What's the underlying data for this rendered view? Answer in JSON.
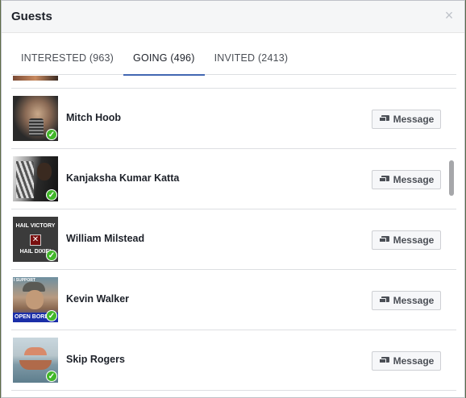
{
  "dialog": {
    "title": "Guests",
    "close_glyph": "×"
  },
  "tabs": [
    {
      "label": "INTERESTED (963)",
      "active": false
    },
    {
      "label": "GOING (496)",
      "active": true
    },
    {
      "label": "INVITED (2413)",
      "active": false
    }
  ],
  "guests": [
    {
      "name": "Mitch Hoob",
      "going": true,
      "button_label": "Message"
    },
    {
      "name": "Kanjaksha Kumar Katta",
      "going": true,
      "button_label": "Message"
    },
    {
      "name": "William Milstead",
      "going": true,
      "button_label": "Message",
      "avatar_text": [
        "HAIL VICTORY",
        "HAIL DIXIE!"
      ]
    },
    {
      "name": "Kevin Walker",
      "going": true,
      "button_label": "Message",
      "avatar_text": [
        "I SUPPORT",
        "OPEN BORD… FOR ISRAEL"
      ]
    },
    {
      "name": "Skip Rogers",
      "going": true,
      "button_label": "Message"
    }
  ],
  "icons": {
    "message": "message-icon",
    "check": "check-icon",
    "close": "close-icon"
  },
  "colors": {
    "accent": "#4267b2",
    "going_badge": "#42b72a"
  }
}
